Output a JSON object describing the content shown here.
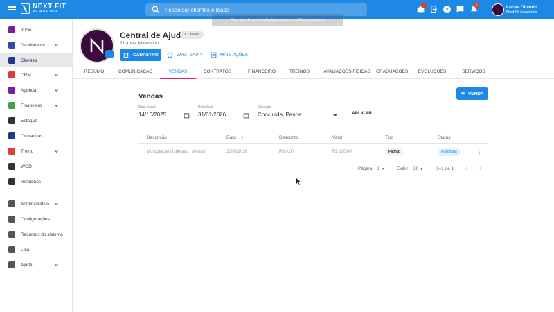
{
  "topbar": {
    "logo_name": "NEXT FIT",
    "logo_sub": "ACADEMIA",
    "search_placeholder": "Pesquisar clientes e leads",
    "chat_badge": "1",
    "user_name": "Lucas Oliverio",
    "user_org": "Next Fit Academia"
  },
  "tooltip": "Para sair do modo tela cheia, toque em  F11  e pressione",
  "sidebar": {
    "items": [
      {
        "label": "Início",
        "icon": "home-icon",
        "color": "#7b1fa2"
      },
      {
        "label": "Dashboards",
        "icon": "chart-icon",
        "color": "#3949ab",
        "chevron": true
      },
      {
        "label": "Clientes",
        "icon": "clients-icon",
        "color": "#1e3a8a",
        "active": true
      },
      {
        "label": "CRM",
        "icon": "crm-icon",
        "color": "#e53935",
        "chevron": true
      },
      {
        "label": "Agenda",
        "icon": "calendar-icon",
        "color": "#7b1fa2",
        "chevron": true
      },
      {
        "label": "Financeiro",
        "icon": "money-icon",
        "color": "#43a047",
        "chevron": true
      },
      {
        "label": "Estoque",
        "icon": "cart-icon",
        "color": "#333333"
      },
      {
        "label": "Comandas",
        "icon": "receipt-icon",
        "color": "#1e3a8a"
      },
      {
        "label": "Treino",
        "icon": "dumbbell-icon",
        "color": "#e53935",
        "chevron": true
      },
      {
        "label": "WOD",
        "icon": "kettlebell-icon",
        "color": "#333333"
      },
      {
        "label": "Relatórios",
        "icon": "report-icon",
        "color": "#333333"
      },
      {
        "label": "Administrativo",
        "icon": "admin-icon",
        "color": "#555555",
        "chevron": true
      },
      {
        "label": "Configurações",
        "icon": "gear-icon",
        "color": "#555555"
      },
      {
        "label": "Recursos do sistema",
        "icon": "toggle-icon",
        "color": "#555555"
      },
      {
        "label": "Loja",
        "icon": "store-icon",
        "color": "#555555"
      },
      {
        "label": "Ajuda",
        "icon": "help-icon",
        "color": "#555555",
        "chevron": true
      }
    ]
  },
  "client": {
    "name": "Central de Ajuda",
    "status": "Inativo",
    "meta": "21 anos, Masculino",
    "btn_cadastro": "CADASTRO",
    "btn_whatsapp": "WHATSAPP",
    "btn_more": "MAIS AÇÕES"
  },
  "tabs": [
    "RESUMO",
    "COMUNICAÇÃO",
    "VENDAS",
    "CONTRATOS",
    "FINANCEIRO",
    "TREINOS",
    "AVALIAÇÕES FÍSICAS",
    "GRADUAÇÕES",
    "EVOLUÇÕES",
    "SERVIÇOS"
  ],
  "vendas": {
    "title": "Vendas",
    "btn_new": "VENDA",
    "start_label": "Data inicial",
    "start_value": "14/10/2025",
    "end_label": "Data final",
    "end_value": "31/01/2026",
    "status_label": "Situação",
    "status_value": "Concluída, Pende...",
    "apply": "APLICAR",
    "columns": [
      "Descrição",
      "Data",
      "Desconto",
      "Valor",
      "Tipo",
      "Status"
    ],
    "rows": [
      {
        "descricao": "Musculação | Liberado | Mensal",
        "data": "20/01/2026",
        "desconto": "R$ 0,00",
        "valor": "R$ 100,00",
        "tipo": "Padrão",
        "status": "Agendada"
      }
    ],
    "pager": {
      "page_label": "Página",
      "page_value": "1",
      "show_label": "Exibir",
      "show_value": "20",
      "range": "1–1 de 1"
    }
  },
  "colors": {
    "primary": "#1e88e5",
    "tab_underline": "#e91e63",
    "avatar": "#3b0a3d"
  }
}
